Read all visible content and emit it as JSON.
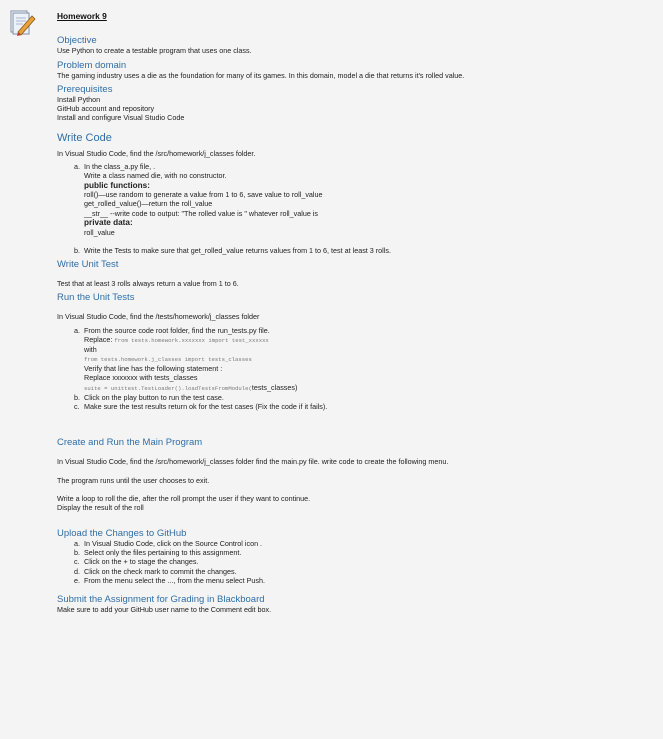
{
  "title": "Homework 9",
  "objective": {
    "heading": "Objective",
    "text": "Use Python to create a testable program that uses one class."
  },
  "problem_domain": {
    "heading": "Problem domain",
    "text": "The gaming industry uses a die as the foundation for many of its games. In this domain, model a die that returns it's rolled value."
  },
  "prerequisites": {
    "heading": "Prerequisites",
    "items": [
      "Install Python",
      "GitHub account and repository",
      "Install and configure Visual Studio Code"
    ]
  },
  "write_code": {
    "heading": "Write Code",
    "intro": "In Visual Studio Code, find the /src/homework/j_classes folder.",
    "a_marker": "a.",
    "a_text": "In the class_a.py file, .",
    "a_lines": [
      "Write a class named die, with no constructor."
    ],
    "public_label": "public functions:",
    "public_lines": [
      "roll()—use random to generate a value from 1 to 6, save value to roll_value",
      "get_rolled_value()—return the roll_value",
      "__str__ --write code to output: \"The rolled value is \" whatever roll_value is"
    ],
    "private_label": "private data:",
    "private_lines": [
      "roll_value"
    ],
    "b_marker": "b.",
    "b_text": "Write the Tests to make sure that get_rolled_value returns values from 1 to 6, test at least 3 rolls."
  },
  "write_unit_test": {
    "heading": "Write Unit Test",
    "text": "Test that at least 3 rolls always return a value from 1 to 6."
  },
  "run_unit_tests": {
    "heading": "Run the Unit Tests",
    "intro": "In Visual Studio Code, find the /tests/homework/j_classes folder",
    "a_marker": "a.",
    "a_text": "From the source code root folder, find the run_tests.py file.",
    "replace_label": "Replace:",
    "replace_code": "from tests.homework.xxxxxxx import test_xxxxxx",
    "with_label": "with",
    "with_code": "from tests.homework.j_classes import tests_classes",
    "verify_text": "Verify that line has the following statement :",
    "replace2_text": "Replace xxxxxxx with tests_classes",
    "suite_code": "suite = unittest.TestLoader().loadTestsFromModule(",
    "suite_tail": "tests_classes)",
    "b_marker": "b.",
    "b_text": "Click on the play button to run the test case.",
    "c_marker": "c.",
    "c_text": "Make sure the test results return ok for the test cases (Fix the code if it fails)."
  },
  "main_program": {
    "heading": "Create and Run the Main Program",
    "text1": "In Visual Studio Code, find the /src/homework/j_classes folder find the main.py file. write code to create the following menu.",
    "text2": "The program runs until the user chooses to exit.",
    "text3": "Write a loop to roll the die, after the roll prompt the user if they want to continue.",
    "text4": "Display the result of the roll"
  },
  "upload": {
    "heading": "Upload the Changes to GitHub",
    "items": [
      {
        "m": "a.",
        "t": "In Visual Studio Code, click on the Source Control icon ."
      },
      {
        "m": "b.",
        "t": "Select only the files pertaining to this assignment."
      },
      {
        "m": "c.",
        "t": "Click on the + to stage the changes."
      },
      {
        "m": "d.",
        "t": "Click on the check mark to commit the changes."
      },
      {
        "m": "e.",
        "t": "From the menu select the ..., from the menu select Push."
      }
    ]
  },
  "submit": {
    "heading": "Submit the Assignment for Grading in Blackboard",
    "text": "Make sure to add your GitHub user name to the Comment edit box."
  },
  "colors": {
    "heading": "#2f6ea8",
    "background": "#f4f4f4"
  },
  "icons": {
    "document": "document-pencil-icon"
  }
}
